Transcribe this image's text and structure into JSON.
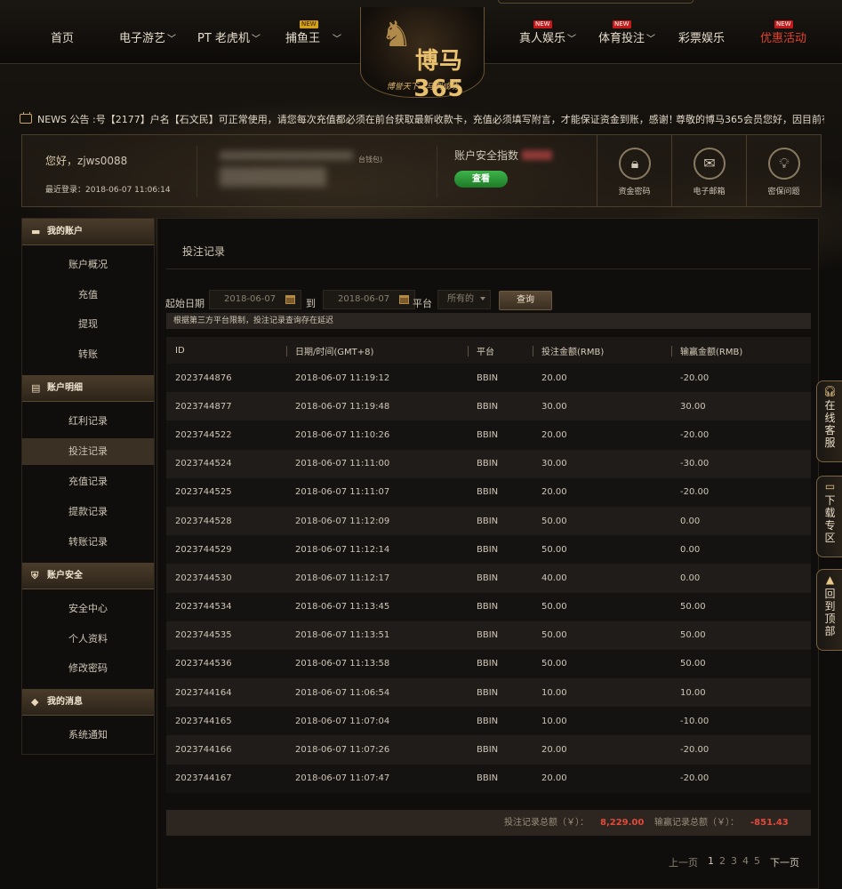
{
  "nav": {
    "items": [
      {
        "label": "首页",
        "has_dropdown": false,
        "badge": ""
      },
      {
        "label": "电子游艺",
        "has_dropdown": true,
        "badge": ""
      },
      {
        "label": "PT 老虎机",
        "has_dropdown": true,
        "badge": ""
      },
      {
        "label": "捕鱼王",
        "has_dropdown": true,
        "badge": "NEW"
      },
      {
        "label": "真人娱乐",
        "has_dropdown": true,
        "badge": "NEW"
      },
      {
        "label": "体育投注",
        "has_dropdown": true,
        "badge": "NEW"
      },
      {
        "label": "彩票娱乐",
        "has_dropdown": false,
        "badge": ""
      },
      {
        "label": "优惠活动",
        "has_dropdown": false,
        "badge": "NEW"
      }
    ],
    "logo": {
      "brand": "博马365",
      "slogan": "博誉天下 · 马到成功"
    }
  },
  "notice": {
    "label": "NEWS 公告 :",
    "message": "号【2177】户名【石文民】可正常使用，请您每次充值都必须在前台获取最新收款卡，充值必须填写附言，才能保证资金到账，感谢！",
    "message2": "尊敬的博马365会员您好，因目前有"
  },
  "user": {
    "greeting": "您好，",
    "username": "zjws0088",
    "last_login_label": "最近登录：",
    "last_login": "2018-06-07 11:06:14",
    "wallet_note": "台钱包)",
    "security_label": "账户安全指数",
    "view_button": "查看",
    "quick": [
      {
        "label": "资金密码",
        "icon": "lock-icon"
      },
      {
        "label": "电子邮箱",
        "icon": "envelope-icon"
      },
      {
        "label": "密保问题",
        "icon": "lightbulb-icon"
      }
    ]
  },
  "sidebar": {
    "sections": [
      {
        "title": "我的账户",
        "icon": "card-icon",
        "items": [
          "账户概况",
          "充值",
          "提现",
          "转账"
        ]
      },
      {
        "title": "账户明细",
        "icon": "document-icon",
        "items": [
          "红利记录",
          "投注记录",
          "充值记录",
          "提款记录",
          "转账记录"
        ]
      },
      {
        "title": "账户安全",
        "icon": "shield-icon",
        "items": [
          "安全中心",
          "个人资料",
          "修改密码"
        ]
      },
      {
        "title": "我的消息",
        "icon": "diamond-icon",
        "items": [
          "系统通知"
        ]
      }
    ],
    "active": "投注记录"
  },
  "main": {
    "title": "投注记录",
    "filter": {
      "start_label": "起始日期",
      "start_date": "2018-06-07",
      "to_label": "到",
      "end_date": "2018-06-07",
      "platform_label": "平台",
      "platform_value": "所有的",
      "query_button": "查询"
    },
    "hint": "根据第三方平台限制，投注记录查询存在延迟",
    "columns": [
      "ID",
      "日期/时间(GMT+8)",
      "平台",
      "投注金额(RMB)",
      "输赢金额(RMB)"
    ],
    "rows": [
      [
        "2023744876",
        "2018-06-07 11:19:12",
        "BBIN",
        "20.00",
        "-20.00"
      ],
      [
        "2023744877",
        "2018-06-07 11:19:48",
        "BBIN",
        "30.00",
        "30.00"
      ],
      [
        "2023744522",
        "2018-06-07 11:10:26",
        "BBIN",
        "20.00",
        "-20.00"
      ],
      [
        "2023744524",
        "2018-06-07 11:11:00",
        "BBIN",
        "30.00",
        "-30.00"
      ],
      [
        "2023744525",
        "2018-06-07 11:11:07",
        "BBIN",
        "20.00",
        "-20.00"
      ],
      [
        "2023744528",
        "2018-06-07 11:12:09",
        "BBIN",
        "50.00",
        "0.00"
      ],
      [
        "2023744529",
        "2018-06-07 11:12:14",
        "BBIN",
        "50.00",
        "0.00"
      ],
      [
        "2023744530",
        "2018-06-07 11:12:17",
        "BBIN",
        "40.00",
        "0.00"
      ],
      [
        "2023744534",
        "2018-06-07 11:13:45",
        "BBIN",
        "50.00",
        "50.00"
      ],
      [
        "2023744535",
        "2018-06-07 11:13:51",
        "BBIN",
        "50.00",
        "50.00"
      ],
      [
        "2023744536",
        "2018-06-07 11:13:58",
        "BBIN",
        "50.00",
        "50.00"
      ],
      [
        "2023744164",
        "2018-06-07 11:06:54",
        "BBIN",
        "10.00",
        "10.00"
      ],
      [
        "2023744165",
        "2018-06-07 11:07:04",
        "BBIN",
        "10.00",
        "-10.00"
      ],
      [
        "2023744166",
        "2018-06-07 11:07:26",
        "BBIN",
        "20.00",
        "-20.00"
      ],
      [
        "2023744167",
        "2018-06-07 11:07:47",
        "BBIN",
        "20.00",
        "-20.00"
      ]
    ],
    "totals": {
      "bet_label": "投注记录总额（￥）：",
      "bet_value": "8,229.00",
      "win_label": "输赢记录总额（￥）：",
      "win_value": "-851.43"
    },
    "pager": {
      "prev": "上一页",
      "pages": [
        "1",
        "2",
        "3",
        "4",
        "5"
      ],
      "current": "1",
      "next": "下一页"
    }
  },
  "float_buttons": [
    {
      "label": "在线客服",
      "icon": "headset-icon"
    },
    {
      "label": "下载专区",
      "icon": "monitor-icon"
    },
    {
      "label": "回到顶部",
      "icon": "rocket-icon"
    }
  ],
  "colors": {
    "accent": "#c9a565",
    "negative": "#e14a3a",
    "view_button": "#2e9b3a",
    "promo": "#e0442e"
  }
}
